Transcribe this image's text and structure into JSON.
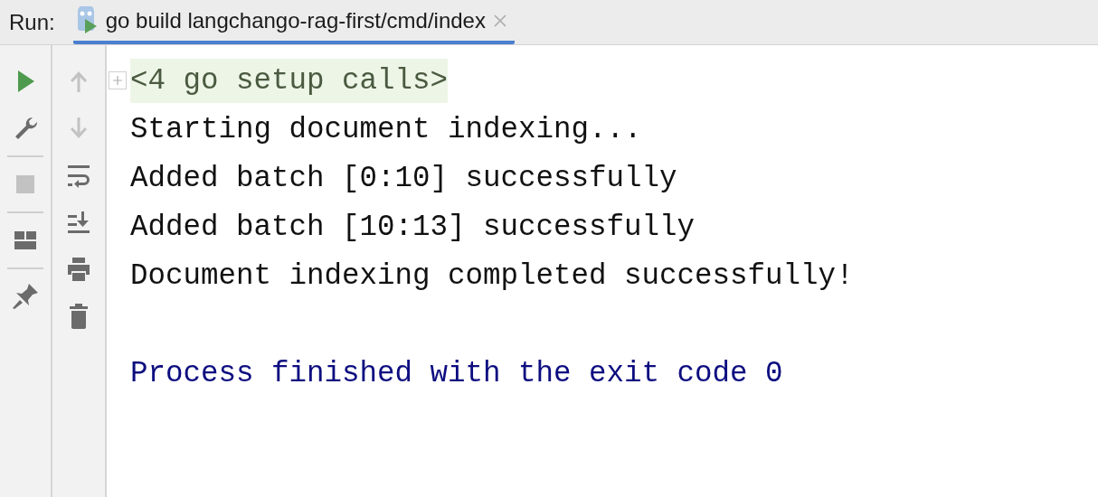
{
  "run_bar": {
    "label": "Run:",
    "tabs": [
      {
        "label": "go build langchango-rag-first/cmd/index",
        "selected": true
      }
    ]
  },
  "left_toolbar": [
    {
      "kind": "run",
      "disabled": false
    },
    {
      "kind": "wrench",
      "disabled": false
    },
    {
      "kind": "divider"
    },
    {
      "kind": "stop",
      "disabled": true
    },
    {
      "kind": "divider"
    },
    {
      "kind": "layout",
      "disabled": false
    },
    {
      "kind": "divider"
    },
    {
      "kind": "pin",
      "disabled": false
    }
  ],
  "console_toolbar": [
    {
      "kind": "up",
      "disabled": true
    },
    {
      "kind": "down",
      "disabled": true
    },
    {
      "kind": "wrap",
      "disabled": false
    },
    {
      "kind": "scroll-end",
      "disabled": false
    },
    {
      "kind": "print",
      "disabled": false
    },
    {
      "kind": "trash",
      "disabled": false
    }
  ],
  "console": [
    {
      "kind": "folded",
      "text": "<4 go setup calls>",
      "expanded": false
    },
    {
      "kind": "output",
      "text": "Starting document indexing..."
    },
    {
      "kind": "output",
      "text": "Added batch [0:10] successfully"
    },
    {
      "kind": "output",
      "text": "Added batch [10:13] successfully"
    },
    {
      "kind": "output",
      "text": "Document indexing completed successfully!"
    },
    {
      "kind": "exit",
      "text": "Process finished with the exit code 0"
    }
  ]
}
